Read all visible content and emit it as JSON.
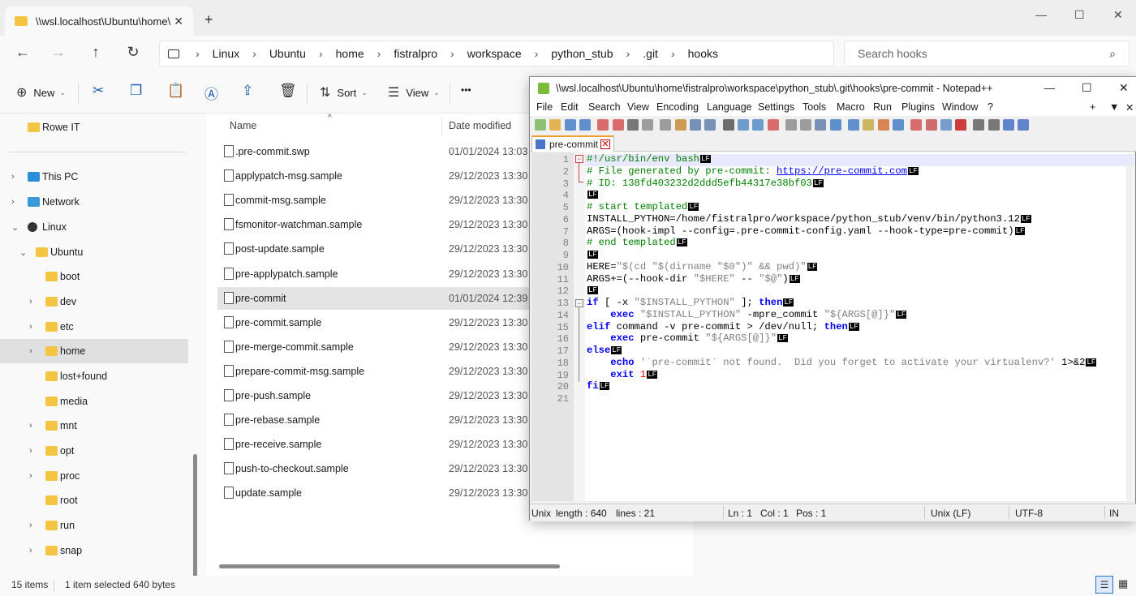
{
  "explorer": {
    "tab_title": "\\\\wsl.localhost\\Ubuntu\\home\\",
    "tab_close": "✕",
    "new_tab": "+",
    "window_controls": [
      "—",
      "☐",
      "✕"
    ],
    "nav_buttons": [
      "←",
      "→",
      "↑",
      "↻"
    ],
    "breadcrumbs": [
      "Linux",
      "Ubuntu",
      "home",
      "fistralpro",
      "workspace",
      "python_stub",
      ".git",
      "hooks"
    ],
    "breadcrumb_sep": "›",
    "search_placeholder": "Search hooks",
    "toolbar": {
      "new_label": "New",
      "sort_label": "Sort",
      "view_label": "View",
      "more": "•••"
    },
    "nav_items": [
      {
        "label": "Rowe IT",
        "indent": 0,
        "chevron": "",
        "icon": "folder"
      },
      {
        "label": "This PC",
        "indent": 0,
        "chevron": "›",
        "icon": "pc"
      },
      {
        "label": "Network",
        "indent": 0,
        "chevron": "›",
        "icon": "network"
      },
      {
        "label": "Linux",
        "indent": 0,
        "chevron": "⌄",
        "icon": "linux"
      },
      {
        "label": "Ubuntu",
        "indent": 1,
        "chevron": "⌄",
        "icon": "folder"
      },
      {
        "label": "boot",
        "indent": 2,
        "chevron": "",
        "icon": "folder"
      },
      {
        "label": "dev",
        "indent": 2,
        "chevron": "›",
        "icon": "folder"
      },
      {
        "label": "etc",
        "indent": 2,
        "chevron": "›",
        "icon": "folder"
      },
      {
        "label": "home",
        "indent": 2,
        "chevron": "›",
        "icon": "folder",
        "selected": true
      },
      {
        "label": "lost+found",
        "indent": 2,
        "chevron": "",
        "icon": "folder"
      },
      {
        "label": "media",
        "indent": 2,
        "chevron": "",
        "icon": "folder"
      },
      {
        "label": "mnt",
        "indent": 2,
        "chevron": "›",
        "icon": "folder"
      },
      {
        "label": "opt",
        "indent": 2,
        "chevron": "›",
        "icon": "folder"
      },
      {
        "label": "proc",
        "indent": 2,
        "chevron": "›",
        "icon": "folder"
      },
      {
        "label": "root",
        "indent": 2,
        "chevron": "",
        "icon": "folder"
      },
      {
        "label": "run",
        "indent": 2,
        "chevron": "›",
        "icon": "folder"
      },
      {
        "label": "snap",
        "indent": 2,
        "chevron": "›",
        "icon": "folder"
      }
    ],
    "columns": {
      "name": "Name",
      "date_modified": "Date modified"
    },
    "files": [
      {
        "name": ".pre-commit.swp",
        "date": "01/01/2024 13:03"
      },
      {
        "name": "applypatch-msg.sample",
        "date": "29/12/2023 13:30"
      },
      {
        "name": "commit-msg.sample",
        "date": "29/12/2023 13:30"
      },
      {
        "name": "fsmonitor-watchman.sample",
        "date": "29/12/2023 13:30"
      },
      {
        "name": "post-update.sample",
        "date": "29/12/2023 13:30"
      },
      {
        "name": "pre-applypatch.sample",
        "date": "29/12/2023 13:30"
      },
      {
        "name": "pre-commit",
        "date": "01/01/2024 12:39",
        "selected": true
      },
      {
        "name": "pre-commit.sample",
        "date": "29/12/2023 13:30"
      },
      {
        "name": "pre-merge-commit.sample",
        "date": "29/12/2023 13:30"
      },
      {
        "name": "prepare-commit-msg.sample",
        "date": "29/12/2023 13:30"
      },
      {
        "name": "pre-push.sample",
        "date": "29/12/2023 13:30"
      },
      {
        "name": "pre-rebase.sample",
        "date": "29/12/2023 13:30"
      },
      {
        "name": "pre-receive.sample",
        "date": "29/12/2023 13:30"
      },
      {
        "name": "push-to-checkout.sample",
        "date": "29/12/2023 13:30"
      },
      {
        "name": "update.sample",
        "date": "29/12/2023 13:30"
      }
    ],
    "status": {
      "items_count": "15 items",
      "selection": "1 item selected  640 bytes"
    }
  },
  "npp": {
    "title": "\\\\wsl.localhost\\Ubuntu\\home\\fistralpro\\workspace\\python_stub\\.git\\hooks\\pre-commit - Notepad++",
    "window_controls": [
      "—",
      "☐",
      "✕"
    ],
    "menu": [
      "File",
      "Edit",
      "Search",
      "View",
      "Encoding",
      "Language",
      "Settings",
      "Tools",
      "Macro",
      "Run",
      "Plugins",
      "Window",
      "?"
    ],
    "menu_right": [
      "+",
      "▼",
      "✕"
    ],
    "tab_label": "pre-commit",
    "tab_close": "✕",
    "lf_marker": "LF",
    "line_numbers": [
      "1",
      "2",
      "3",
      "4",
      "5",
      "6",
      "7",
      "8",
      "9",
      "10",
      "11",
      "12",
      "13",
      "14",
      "15",
      "16",
      "17",
      "18",
      "19",
      "20",
      "21"
    ],
    "lines": [
      [
        {
          "t": "#!/usr/bin/env bash",
          "c": "cm"
        }
      ],
      [
        {
          "t": "# File generated by pre-commit: ",
          "c": "cm"
        },
        {
          "t": "https://pre-commit.com",
          "c": "url"
        }
      ],
      [
        {
          "t": "# ID: 138fd403232d2ddd5efb44317e38bf03",
          "c": "cm"
        }
      ],
      [],
      [
        {
          "t": "# start templated",
          "c": "cm"
        }
      ],
      [
        {
          "t": "INSTALL_PYTHON=/home/fistralpro/workspace/python_stub/venv/bin/python3.12",
          "c": ""
        }
      ],
      [
        {
          "t": "ARGS=(hook-impl --config=.pre-commit-config.yaml --hook-type=pre-commit)",
          "c": ""
        }
      ],
      [
        {
          "t": "# end templated",
          "c": "cm"
        }
      ],
      [],
      [
        {
          "t": "HERE=",
          "c": ""
        },
        {
          "t": "\"$(cd \"$(dirname \"$0\")\" && pwd)\"",
          "c": "st"
        }
      ],
      [
        {
          "t": "ARGS+=(--hook-dir ",
          "c": ""
        },
        {
          "t": "\"$HERE\"",
          "c": "st"
        },
        {
          "t": " -- ",
          "c": ""
        },
        {
          "t": "\"$@\"",
          "c": "st"
        },
        {
          "t": ")",
          "c": ""
        }
      ],
      [],
      [
        {
          "t": "if",
          "c": "kw"
        },
        {
          "t": " [ -x ",
          "c": ""
        },
        {
          "t": "\"$INSTALL_PYTHON\"",
          "c": "st"
        },
        {
          "t": " ]; ",
          "c": ""
        },
        {
          "t": "then",
          "c": "kw"
        }
      ],
      [
        {
          "t": "    ",
          "c": ""
        },
        {
          "t": "exec",
          "c": "kw"
        },
        {
          "t": " ",
          "c": ""
        },
        {
          "t": "\"$INSTALL_PYTHON\"",
          "c": "st"
        },
        {
          "t": " -mpre_commit ",
          "c": ""
        },
        {
          "t": "\"${ARGS[@]}\"",
          "c": "st"
        }
      ],
      [
        {
          "t": "elif",
          "c": "kw"
        },
        {
          "t": " command -v pre-commit > /dev/null; ",
          "c": ""
        },
        {
          "t": "then",
          "c": "kw"
        }
      ],
      [
        {
          "t": "    ",
          "c": ""
        },
        {
          "t": "exec",
          "c": "kw"
        },
        {
          "t": " pre-commit ",
          "c": ""
        },
        {
          "t": "\"${ARGS[@]}\"",
          "c": "st"
        }
      ],
      [
        {
          "t": "else",
          "c": "kw"
        }
      ],
      [
        {
          "t": "    ",
          "c": ""
        },
        {
          "t": "echo",
          "c": "kw"
        },
        {
          "t": " ",
          "c": ""
        },
        {
          "t": "'`pre-commit` not found.  Did you forget to activate your virtualenv?'",
          "c": "st"
        },
        {
          "t": " 1>&2",
          "c": ""
        }
      ],
      [
        {
          "t": "    ",
          "c": ""
        },
        {
          "t": "exit",
          "c": "kw"
        },
        {
          "t": " ",
          "c": ""
        },
        {
          "t": "1",
          "c": "num"
        }
      ],
      [
        {
          "t": "fi",
          "c": "kw"
        }
      ],
      []
    ],
    "lf_lines": [
      true,
      true,
      true,
      true,
      true,
      true,
      true,
      true,
      true,
      true,
      true,
      true,
      true,
      true,
      true,
      true,
      true,
      true,
      true,
      true,
      false
    ],
    "status": {
      "type": "Unix script file",
      "type_short": "Unix",
      "length": "length : 640",
      "lines": "lines : 21",
      "ln": "Ln : 1",
      "col": "Col : 1",
      "pos": "Pos : 1",
      "eol": "Unix (LF)",
      "encoding": "UTF-8",
      "mode": "IN"
    }
  }
}
